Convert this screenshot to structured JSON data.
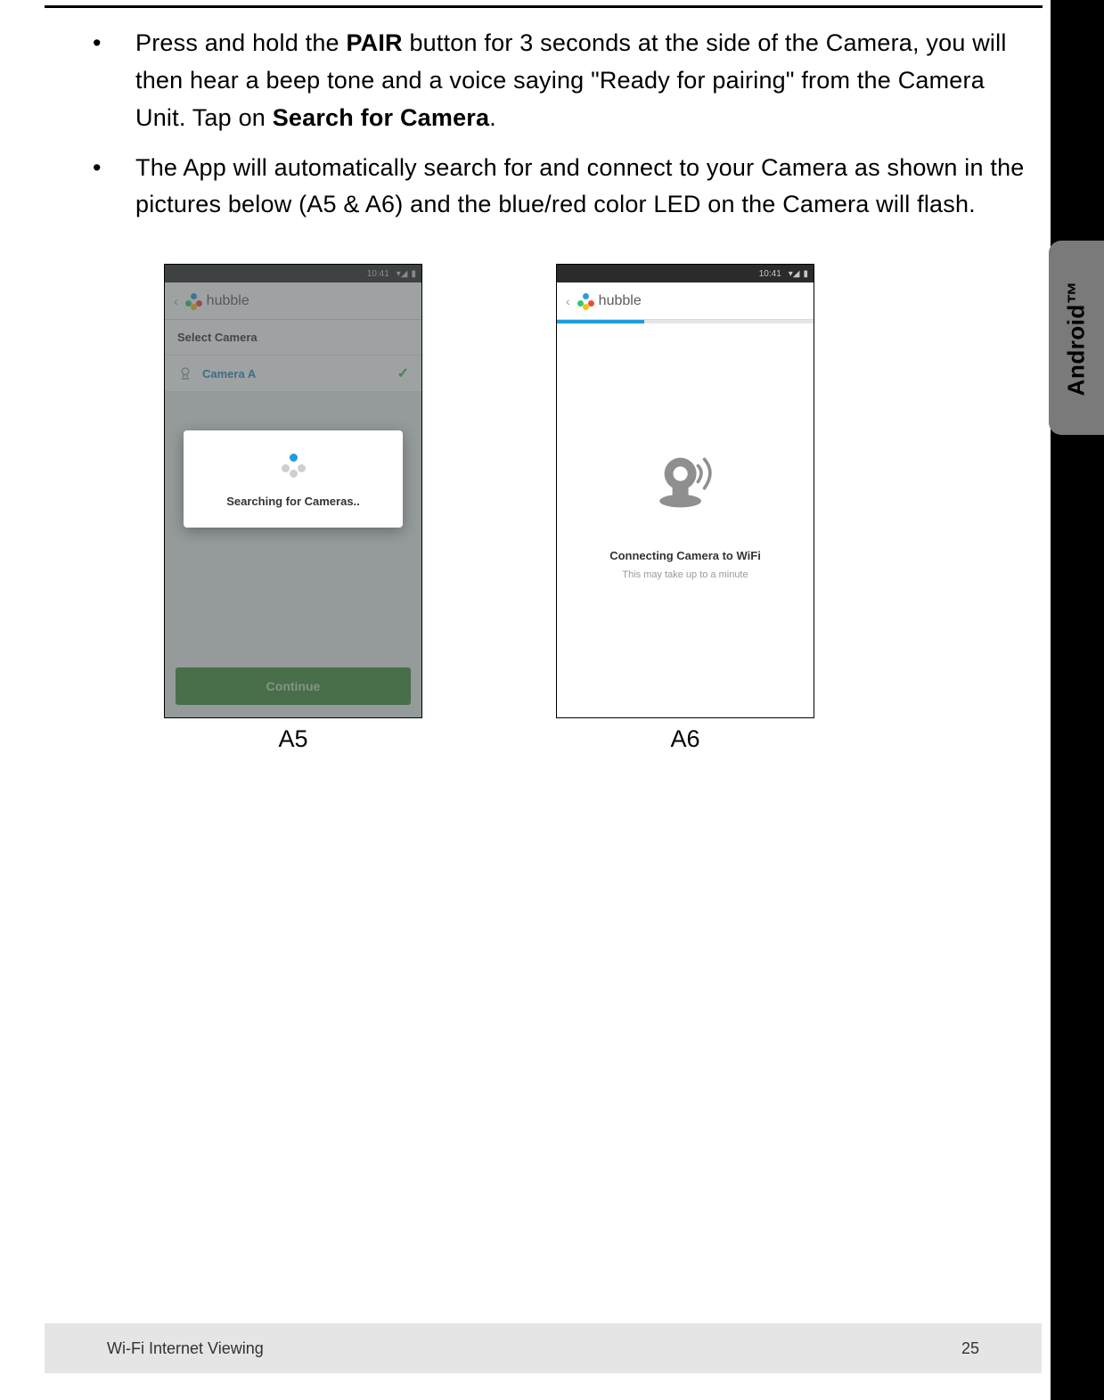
{
  "bullets": {
    "b1_pre": "Press and hold the ",
    "b1_pair": "PAIR",
    "b1_mid": " button for 3 seconds at the side of the Camera, you will then hear a beep tone and a voice saying \"Ready for pairing\" from the Camera Unit. Tap on ",
    "b1_search": "Search for Camera",
    "b1_post": ".",
    "b2": "The App will automatically search for and connect to your Camera as shown in the pictures below (A5 & A6) and the blue/red color LED on the Camera will flash."
  },
  "status_time": "10:41",
  "appbar_brand": "hubble",
  "a5": {
    "select_header": "Select Camera",
    "camera_name": "Camera A",
    "dialog_text": "Searching for Cameras..",
    "continue": "Continue",
    "caption": "A5"
  },
  "a6": {
    "title": "Connecting Camera to WiFi",
    "sub": "This may take up to a minute",
    "caption": "A6"
  },
  "sidetab": "Android™",
  "footer": {
    "title": "Wi-Fi Internet Viewing",
    "page": "25"
  }
}
